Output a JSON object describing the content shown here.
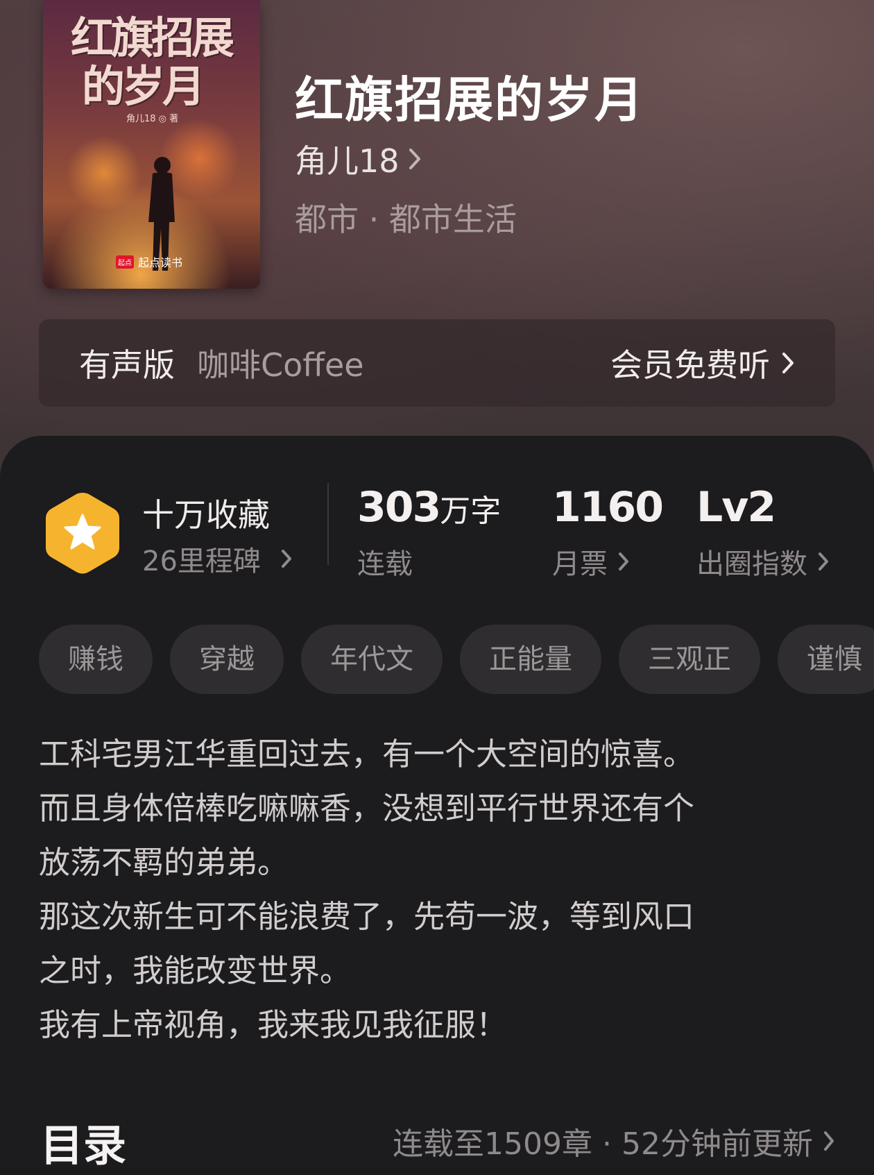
{
  "cover": {
    "title_line1": "红旗招展",
    "title_line2": "的岁月",
    "author_mark": "角儿18 ◎ 著",
    "brand_badge": "起点",
    "brand": "起点读书"
  },
  "book": {
    "title": "红旗招展的岁月",
    "author": "角儿18",
    "category": "都市 · 都市生活"
  },
  "audio": {
    "label": "有声版",
    "narrator": "咖啡Coffee",
    "action": "会员免费听"
  },
  "stats": {
    "collect_title": "十万收藏",
    "collect_sub": "26里程碑",
    "words_value": "303",
    "words_unit": "万字",
    "words_sub": "连载",
    "tickets_value": "1160",
    "tickets_sub": "月票",
    "level_value": "Lv2",
    "level_sub": "出圈指数"
  },
  "tags": [
    "赚钱",
    "穿越",
    "年代文",
    "正能量",
    "三观正",
    "谨慎"
  ],
  "synopsis": [
    "工科宅男江华重回过去，有一个大空间的惊喜。",
    "而且身体倍棒吃嘛嘛香，没想到平行世界还有个",
    "放荡不羁的弟弟。",
    "那这次新生可不能浪费了，先苟一波，等到风口",
    "之时，我能改变世界。",
    "我有上帝视角，我来我见我征服！"
  ],
  "toc": {
    "title": "目录",
    "info": "连载至1509章 · 52分钟前更新"
  },
  "colors": {
    "hexagon": "#f6b42e",
    "card_bg": "#1c1b1d",
    "tag_bg": "#2f2d2f"
  }
}
